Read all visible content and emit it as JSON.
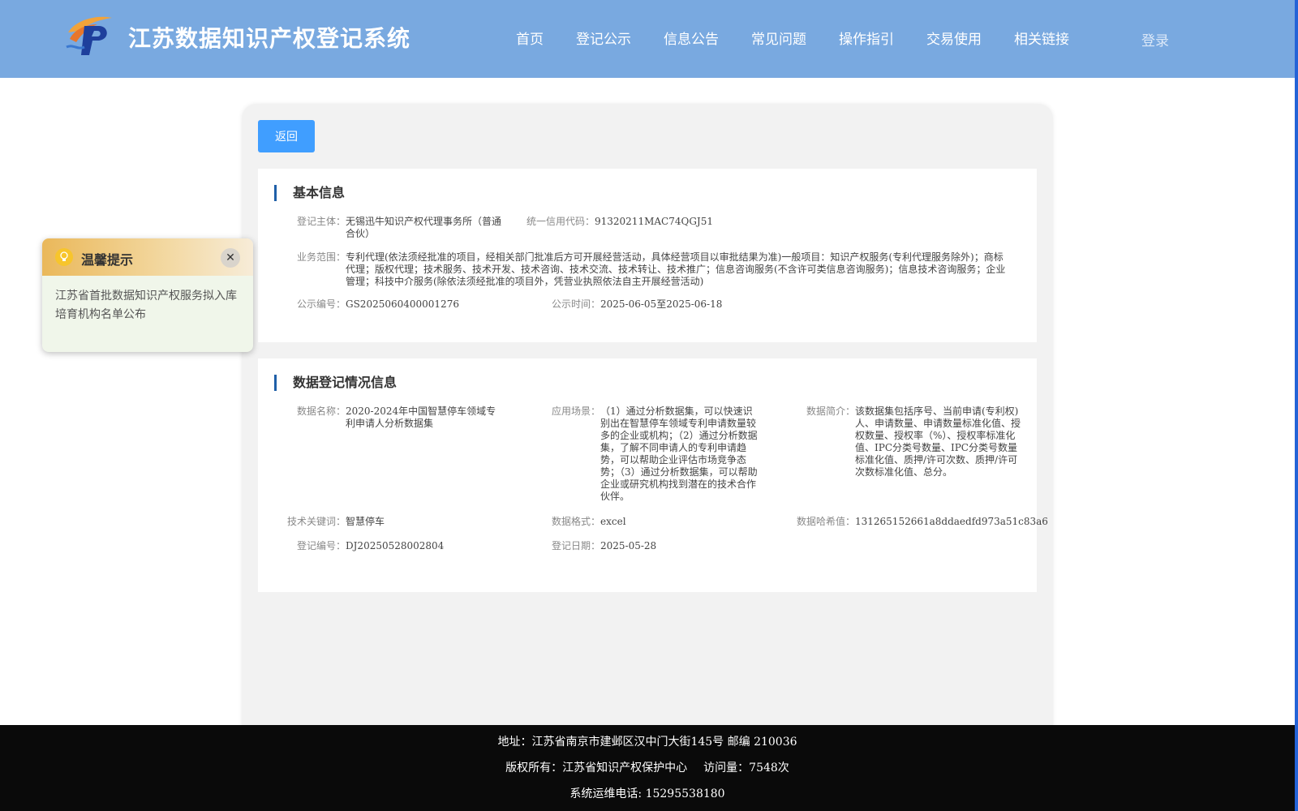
{
  "header": {
    "site_title": "江苏数据知识产权登记系统",
    "nav": [
      "首页",
      "登记公示",
      "信息公告",
      "常见问题",
      "操作指引",
      "交易使用",
      "相关链接"
    ],
    "login": "登录"
  },
  "toolbar": {
    "back_label": "返回"
  },
  "basic_info": {
    "title": "基本信息",
    "subject_label": "登记主体：",
    "subject_value": "无锡迅牛知识产权代理事务所（普通合伙）",
    "credit_code_label": "统一信用代码：",
    "credit_code_value": "91320211MAC74QGJ51",
    "scope_label": "业务范围：",
    "scope_value": "专利代理(依法须经批准的项目，经相关部门批准后方可开展经营活动，具体经营项目以审批结果为准)一般项目：知识产权服务(专利代理服务除外)；商标代理；版权代理；技术服务、技术开发、技术咨询、技术交流、技术转让、技术推广；信息咨询服务(不含许可类信息咨询服务)；信息技术咨询服务；企业管理；科技中介服务(除依法须经批准的项目外，凭营业执照依法自主开展经营活动)",
    "notice_no_label": "公示编号：",
    "notice_no_value": "GS2025060400001276",
    "notice_time_label": "公示时间：",
    "notice_time_value": "2025-06-05至2025-06-18"
  },
  "data_info": {
    "title": "数据登记情况信息",
    "name_label": "数据名称：",
    "name_value": "2020-2024年中国智慧停车领域专利申请人分析数据集",
    "scenario_label": "应用场景：",
    "scenario_value": "（1）通过分析数据集，可以快速识别出在智慧停车领域专利申请数量较多的企业或机构；（2）通过分析数据集，了解不同申请人的专利申请趋势，可以帮助企业评估市场竞争态势；（3）通过分析数据集，可以帮助企业或研究机构找到潜在的技术合作伙伴。",
    "intro_label": "数据简介：",
    "intro_value": "该数据集包括序号、当前申请(专利权)人、申请数量、申请数量标准化值、授权数量、授权率（%）、授权率标准化值、IPC分类号数量、IPC分类号数量标准化值、质押/许可次数、质押/许可次数标准化值、总分。",
    "keyword_label": "技术关键词：",
    "keyword_value": "智慧停车",
    "format_label": "数据格式：",
    "format_value": "excel",
    "hash_label": "数据哈希值：",
    "hash_value": "131265152661a8ddaedfd973a51c83a6",
    "reg_no_label": "登记编号：",
    "reg_no_value": "DJ20250528002804",
    "reg_date_label": "登记日期：",
    "reg_date_value": "2025-05-28"
  },
  "notice": {
    "title": "温馨提示",
    "body": "江苏省首批数据知识产权服务拟入库培育机构名单公布"
  },
  "footer": {
    "address": "地址：江苏省南京市建邺区汉中门大街145号 邮编 210036",
    "copyright": "版权所有：江苏省知识产权保护中心",
    "visits": "访问量：7548次",
    "phone": "系统运维电话: 15295538180"
  },
  "colors": {
    "header_bg": "#79a9e0",
    "primary_button": "#409eff",
    "section_accent": "#1f5fa8",
    "footer_bg": "#0a0a0a"
  },
  "icons": [
    "logo-icon",
    "bulb-icon",
    "close-icon"
  ]
}
